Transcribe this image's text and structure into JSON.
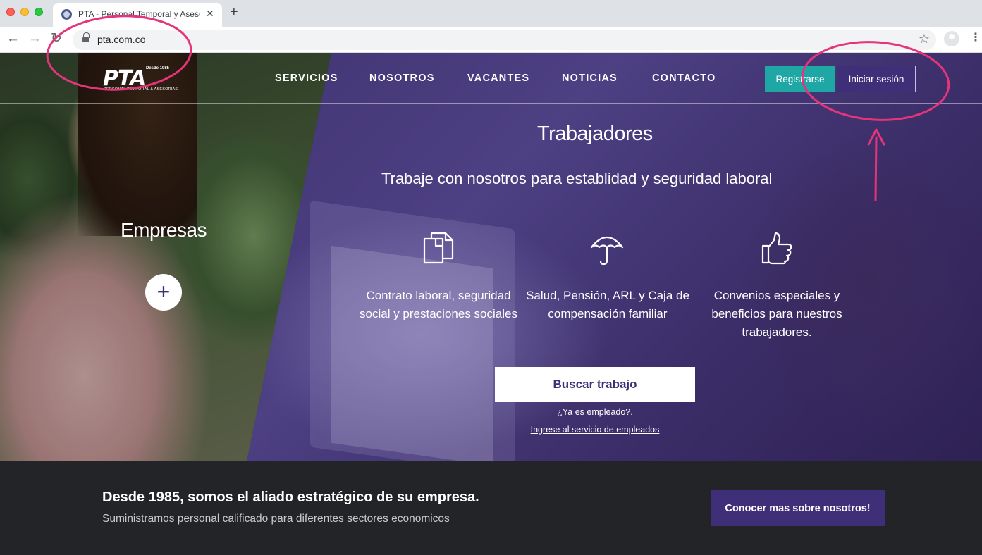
{
  "browser": {
    "tab_title": "PTA - Personal Temporal y Asesorías",
    "tab_close": "✕",
    "new_tab": "+",
    "url": "pta.com.co"
  },
  "site": {
    "logo": {
      "since": "Desde 1985",
      "mark": "PTA",
      "tagline": "PERSONAL TEMPORAL & ASESORIAS"
    },
    "nav": [
      "SERVICIOS",
      "NOSOTROS",
      "VACANTES",
      "NOTICIAS",
      "CONTACTO"
    ],
    "register_label": "Registrarse",
    "login_label": "Iniciar sesión"
  },
  "empresas": {
    "title": "Empresas",
    "expand_symbol": "+"
  },
  "trabajadores": {
    "title": "Trabajadores",
    "subtitle": "Trabaje con nosotros para establidad y seguridad laboral",
    "features": [
      {
        "icon": "documents-icon",
        "text": "Contrato laboral, seguridad social y prestaciones sociales"
      },
      {
        "icon": "umbrella-icon",
        "text": "Salud, Pensión, ARL y Caja de compensación familiar"
      },
      {
        "icon": "thumbs-up-icon",
        "text": "Convenios especiales y beneficios para nuestros trabajadores."
      }
    ],
    "search_button": "Buscar trabajo",
    "already_employee": "¿Ya es empleado?.",
    "employee_link": "Ingrese al servicio de empleados"
  },
  "band": {
    "title": "Desde 1985, somos el aliado estratégico de su empresa.",
    "subtitle": "Suministramos personal calificado para diferentes sectores economicos",
    "cta": "Conocer mas sobre nosotros!"
  },
  "colors": {
    "brand_purple": "#3e2f78",
    "teal": "#1fa7a6",
    "annotation_pink": "#e4347a",
    "band_bg": "#222428"
  }
}
